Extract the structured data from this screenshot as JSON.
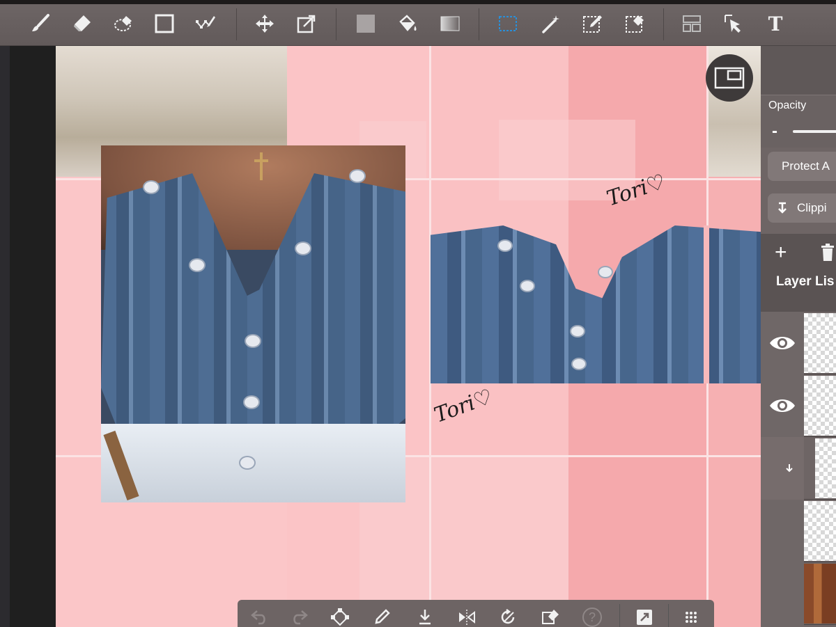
{
  "app": {
    "accent": "#2a8fd8",
    "canvas_color": "#f7b9bb"
  },
  "toolbar": {
    "tools": [
      {
        "name": "brush",
        "icon": "brush-icon"
      },
      {
        "name": "eraser",
        "icon": "eraser-icon"
      },
      {
        "name": "lasso-eraser",
        "icon": "lasso-eraser-icon"
      },
      {
        "name": "shape",
        "icon": "rectangle-icon"
      },
      {
        "name": "stroke-pen",
        "icon": "polyline-pen-icon"
      },
      {
        "name": "move",
        "icon": "move-icon"
      },
      {
        "name": "transform",
        "icon": "transform-icon"
      },
      {
        "name": "fill-color",
        "icon": "fill-square-icon"
      },
      {
        "name": "bucket",
        "icon": "bucket-icon"
      },
      {
        "name": "gradient",
        "icon": "gradient-icon"
      },
      {
        "name": "select",
        "icon": "selection-rect-icon"
      },
      {
        "name": "magic-wand",
        "icon": "magic-wand-icon"
      },
      {
        "name": "select-pen",
        "icon": "select-pen-icon"
      },
      {
        "name": "select-eraser",
        "icon": "select-eraser-icon"
      },
      {
        "name": "frame-divider",
        "icon": "frame-divider-icon"
      },
      {
        "name": "operation",
        "icon": "cursor-select-icon"
      },
      {
        "name": "text",
        "icon": "text-icon",
        "label": "T"
      }
    ]
  },
  "canvas": {
    "signature_1": "Tori♡",
    "signature_2": "Tori♡"
  },
  "panel": {
    "opacity_label": "Opacity",
    "opacity_minus": "-",
    "protect_alpha_label": "Protect A",
    "clipping_label": "Clippi",
    "layer_list_label": "Layer Lis",
    "add_label": "+",
    "layers": [
      {
        "visible": true
      },
      {
        "visible": true
      },
      {
        "clipped": true
      },
      {
        "visible": false
      },
      {
        "visible": false
      },
      {
        "visible": false
      }
    ]
  },
  "bottom_bar": {
    "help_label": "?"
  }
}
